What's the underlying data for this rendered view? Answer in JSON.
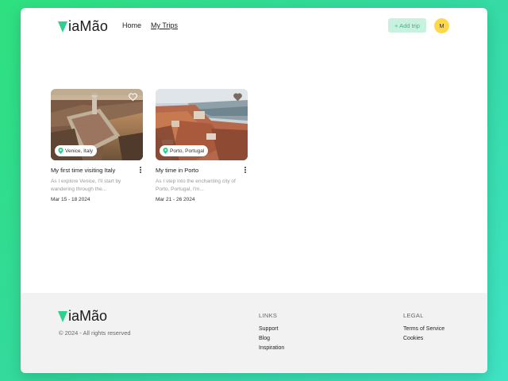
{
  "brand": {
    "name": "iaMão",
    "accent": "#2ecf8f"
  },
  "nav": {
    "home": "Home",
    "my_trips": "My Trips"
  },
  "header": {
    "add_trip": "+ Add trip",
    "avatar_initial": "M"
  },
  "trips": [
    {
      "location": "Venice, Italy",
      "title": "My first time visiting Italy",
      "description": "As I explore Venice, I'll start by wandering through the...",
      "dates": "Mar 15 - 18 2024"
    },
    {
      "location": "Porto, Portugal",
      "title": "My time in Porto",
      "description": "As I step into the enchanting city of Porto, Portugal, I'm...",
      "dates": "Mar 21 - 26 2024"
    }
  ],
  "footer": {
    "copyright": "© 2024 - All rights reserved",
    "links_title": "LINKS",
    "links": [
      "Support",
      "Blog",
      "Inspiration"
    ],
    "legal_title": "LEGAL",
    "legal": [
      "Terms of Service",
      "Cookies"
    ]
  }
}
